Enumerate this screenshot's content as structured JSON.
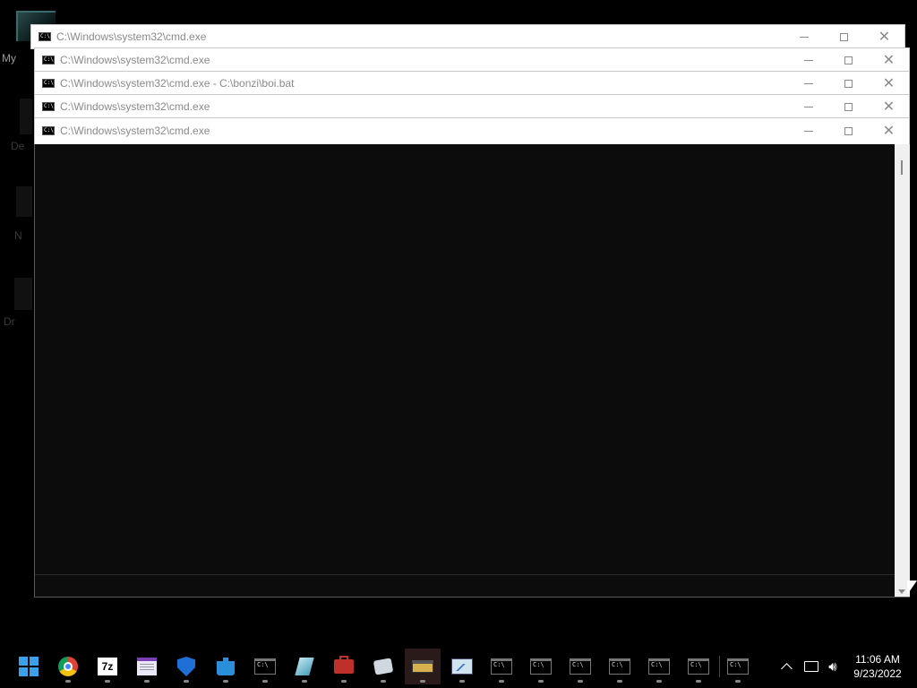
{
  "desktop": {
    "labels": [
      "My",
      "De",
      "N",
      "Dr"
    ]
  },
  "windows": [
    {
      "title": "C:\\Windows\\system32\\cmd.exe"
    },
    {
      "title": "C:\\Windows\\system32\\cmd.exe"
    },
    {
      "title": "C:\\Windows\\system32\\cmd.exe - C:\\bonzi\\boi.bat"
    },
    {
      "title": "C:\\Windows\\system32\\cmd.exe"
    },
    {
      "title": "C:\\Windows\\system32\\cmd.exe"
    }
  ],
  "window_icon_text": "C:\\",
  "window_controls": {
    "minimize": "minimize-icon",
    "maximize": "maximize-icon",
    "close": "close-icon"
  },
  "taskbar": {
    "apps": [
      {
        "name": "start-icon"
      },
      {
        "name": "chrome-icon"
      },
      {
        "name": "7zip-icon",
        "label": "7z"
      },
      {
        "name": "notepad-icon"
      },
      {
        "name": "defender-shield-icon"
      },
      {
        "name": "puzzle-icon"
      },
      {
        "name": "cmd-icon"
      },
      {
        "name": "crystal-icon"
      },
      {
        "name": "toolbox-icon"
      },
      {
        "name": "dice-icon"
      },
      {
        "name": "scanner-icon"
      },
      {
        "name": "resource-monitor-icon"
      },
      {
        "name": "cmd-icon"
      },
      {
        "name": "cmd-icon"
      },
      {
        "name": "cmd-icon"
      },
      {
        "name": "cmd-icon"
      },
      {
        "name": "cmd-icon"
      },
      {
        "name": "cmd-icon"
      },
      {
        "name": "cmd-icon"
      }
    ],
    "tray": {
      "time": "11:06 AM",
      "date": "9/23/2022"
    }
  },
  "colors": {
    "desktop_bg": "#000000",
    "console_bg": "#0c0c0c",
    "accent_start": "#3aa0ea"
  }
}
